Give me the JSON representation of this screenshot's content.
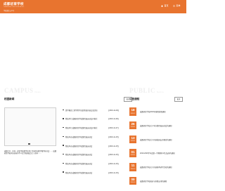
{
  "header": {
    "title": "成都初育学校",
    "subtitle": "CHENGDU CHUYU SCHOOL",
    "subtitle2": "学校微信公众号",
    "nav": [
      {
        "label": "首页",
        "icon": "home-icon"
      },
      {
        "label": "菜单",
        "icon": "menu-icon"
      }
    ],
    "accent": "#e8742f"
  },
  "news": {
    "bg_en": "CAMPUS",
    "bg_small": "News",
    "title": "校园新闻",
    "more": "更多",
    "photo_caption": "成都七中（东区）初育学校数学名师工作室举办数学教学研讨会…… 成都初育学校举办庆祝中华人民共和国成立七十周年……",
    "items": [
      {
        "text": "清华教育工程学院学员赴我校开展交流活动",
        "date": "【2019-12-09】"
      },
      {
        "text": "我校举行成都初育学校第四届运动会开幕式",
        "date": "【2019-11-28】"
      },
      {
        "text": "我校举行成都初育学校第四届运动会开幕式",
        "date": "【2019-11-27】"
      },
      {
        "text": "我校举办成都初育学校第四届运动会",
        "date": "【2019-11-15】"
      },
      {
        "text": "我校举办成都初育学校第四届运动会",
        "date": "【2019-11-15】"
      },
      {
        "text": "我校举办成都初育学校第四届运动会",
        "date": "【2019-11-15】"
      },
      {
        "text": "我校举办成都初育学校第四届运动会",
        "date": "【2019-11-15】"
      },
      {
        "text": "我校举办成都初育学校第四届运动会",
        "date": "【2019-11-15】"
      }
    ]
  },
  "notice": {
    "bg_en": "PUBLIC",
    "bg_small": "Notice",
    "title": "公告通知",
    "more": "更多",
    "items": [
      {
        "day": "18",
        "ym": "2019-12",
        "text": "成都初育学校2020年寒假放假通知"
      },
      {
        "day": "26",
        "ym": "2019-11",
        "text": "成都初育学校关于举办第四届运动会的通知"
      },
      {
        "day": "13",
        "ym": "2019-11",
        "text": "成都初育学校关于开展校园安全教育的通知"
      },
      {
        "day": "01",
        "ym": "2019-11",
        "text": "2019-2020学年度第一学期期中考试安排的通知"
      },
      {
        "day": "11",
        "ym": "2019-10",
        "text": "成都初育学校关于开展秋季研学活动的通知"
      },
      {
        "day": "09",
        "ym": "2019-10",
        "text": "成都初育学校国庆节放假安排的通知"
      }
    ]
  }
}
